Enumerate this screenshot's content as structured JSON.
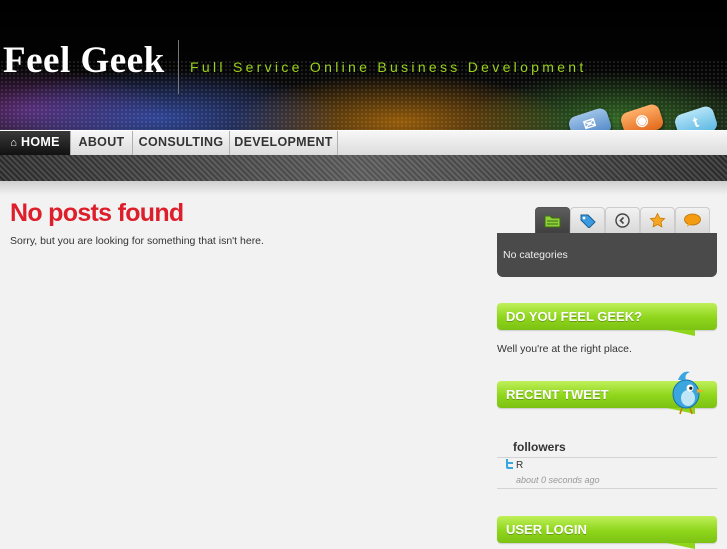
{
  "header": {
    "logo": "Feel Geek",
    "tagline": "Full Service Online Business Development",
    "social_icons": [
      "rss-icon",
      "rss-feed-icon",
      "twitter-icon"
    ]
  },
  "nav": {
    "items": [
      {
        "label": "HOME",
        "icon": "home-icon",
        "active": true
      },
      {
        "label": "ABOUT"
      },
      {
        "label": "CONSULTING"
      },
      {
        "label": "DEVELOPMENT"
      }
    ]
  },
  "main": {
    "title": "No posts found",
    "message": "Sorry, but you are looking for something that isn't here."
  },
  "sidebar": {
    "tabs": [
      "folder-icon",
      "tag-icon",
      "clock-icon",
      "star-icon",
      "comment-icon"
    ],
    "tab_panel_text": "No categories",
    "feel_geek": {
      "title": "DO YOU FEEL GEEK?",
      "text": "Well you're at the right place."
    },
    "recent_tweet": {
      "title": "RECENT TWEET",
      "followers_label": "followers",
      "tweet_text": "R",
      "tweet_time": "about 0 seconds ago"
    },
    "user_login": {
      "title": "USER LOGIN"
    }
  },
  "colors": {
    "accent_green": "#8ed51b",
    "title_red": "#dd1f2b",
    "tagline_green": "#9bd21b",
    "panel_dark": "#4a4a4a"
  }
}
